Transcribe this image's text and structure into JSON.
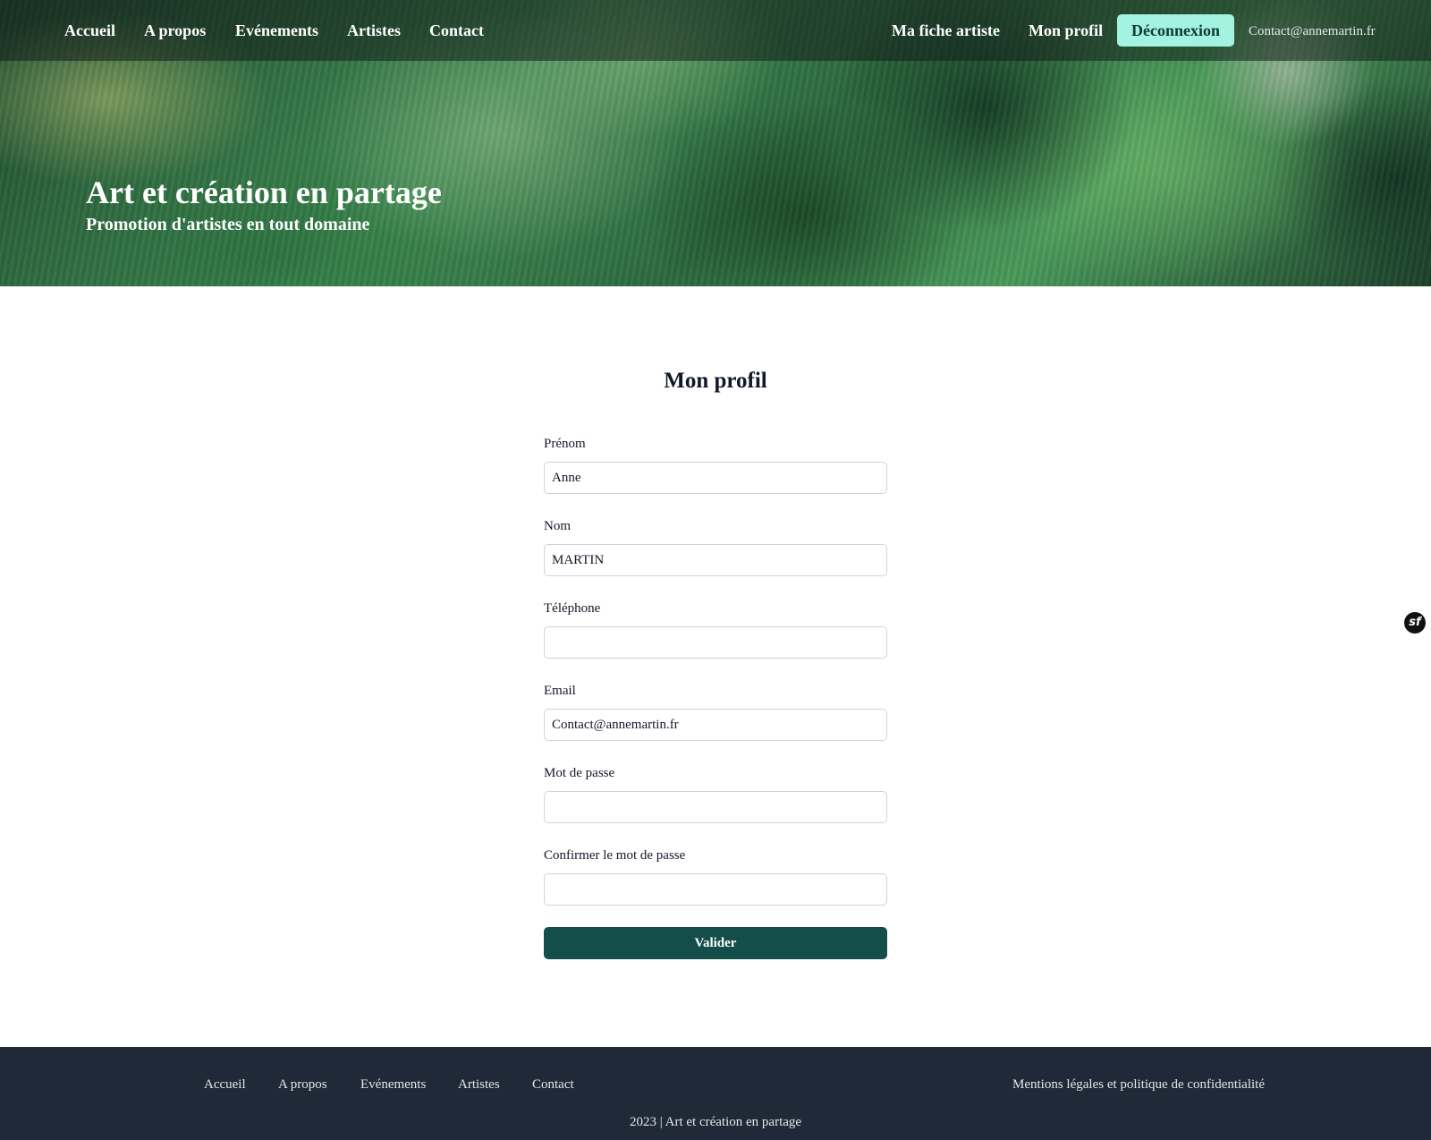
{
  "nav": {
    "links": [
      "Accueil",
      "A propos",
      "Evénements",
      "Artistes",
      "Contact"
    ],
    "right_links": [
      "Ma fiche artiste",
      "Mon profil"
    ],
    "logout_label": "Déconnexion",
    "user_email": "Contact@annemartin.fr"
  },
  "hero": {
    "title": "Art et création en partage",
    "subtitle": "Promotion d'artistes en tout domaine"
  },
  "form": {
    "title": "Mon profil",
    "fields": [
      {
        "label": "Prénom",
        "value": "Anne"
      },
      {
        "label": "Nom",
        "value": "MARTIN"
      },
      {
        "label": "Téléphone",
        "value": ""
      },
      {
        "label": "Email",
        "value": "Contact@annemartin.fr"
      },
      {
        "label": "Mot de passe",
        "value": ""
      },
      {
        "label": "Confirmer le mot de passe",
        "value": ""
      }
    ],
    "submit_label": "Valider"
  },
  "debug_badge": "sf",
  "footer": {
    "links": [
      "Accueil",
      "A propos",
      "Evénements",
      "Artistes",
      "Contact"
    ],
    "legal": "Mentions légales et politique de confidentialité",
    "copyright": "2023 | Art et création en partage"
  },
  "colors": {
    "accent_button": "#a3f3e0",
    "submit_button": "#134e4a",
    "footer_bg": "#1f2937"
  }
}
